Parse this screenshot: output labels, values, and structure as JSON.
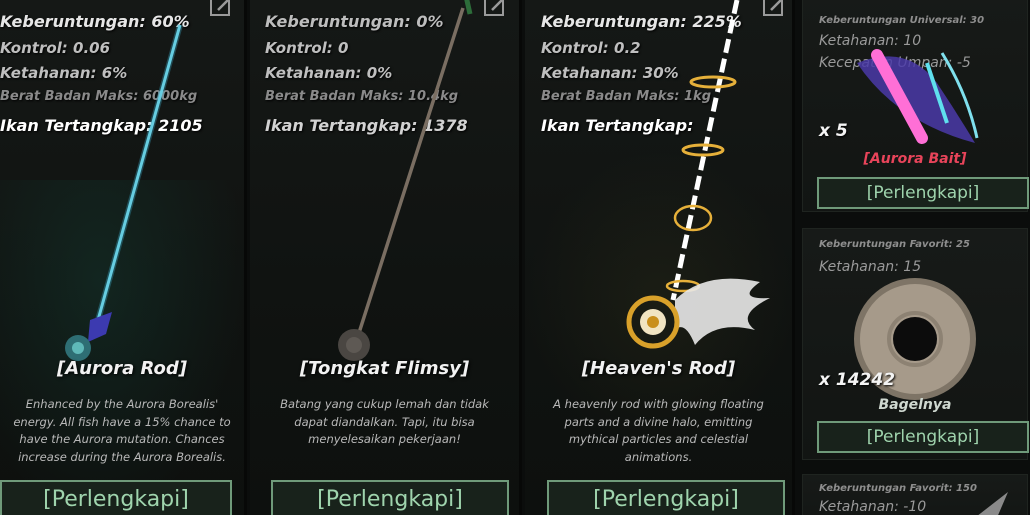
{
  "cards": {
    "aurora": {
      "stats": {
        "luck": "Keberuntungan: 60%",
        "control": "Kontrol: 0.06",
        "resilience": "Ketahanan: 6%",
        "max_weight": "Berat Badan Maks: 6000kg",
        "caught": "Ikan Tertangkap: 2105"
      },
      "name": "[Aurora Rod]",
      "description": "Enhanced by the Aurora Borealis' energy. All fish have a 15% chance to have the Aurora mutation. Chances increase during the Aurora Borealis.",
      "equip_label": "[Perlengkapi]",
      "rod_icon": "aurora-rod-icon"
    },
    "flimsy": {
      "stats": {
        "luck": "Keberuntungan: 0%",
        "control": "Kontrol: 0",
        "resilience": "Ketahanan: 0%",
        "max_weight": "Berat Badan Maks: 10.4kg",
        "caught": "Ikan Tertangkap: 1378"
      },
      "name": "[Tongkat Flimsy]",
      "description": "Batang yang cukup lemah dan tidak dapat diandalkan. Tapi, itu bisa menyelesaikan pekerjaan!",
      "equip_label": "[Perlengkapi]",
      "rod_icon": "flimsy-rod-icon"
    },
    "heaven": {
      "stats": {
        "luck": "Keberuntungan: 225%",
        "control": "Kontrol: 0.2",
        "resilience": "Ketahanan: 30%",
        "max_weight": "Berat Badan Maks: 1kg",
        "caught": "Ikan Tertangkap:"
      },
      "name": "[Heaven's Rod]",
      "description": "A heavenly rod with glowing floating parts and a divine halo, emitting mythical particles and celestial animations.",
      "equip_label": "[Perlengkapi]",
      "rod_icon": "heavens-rod-icon"
    }
  },
  "side": {
    "bait": {
      "tag": "Keberuntungan Universal: 30",
      "stat1": "Ketahanan: 10",
      "stat2": "Kecepatan Umpan: -5",
      "qty": "x 5",
      "name": "[Aurora Bait]",
      "name_color": "#e8445a",
      "equip_label": "[Perlengkapi]",
      "icon": "aurora-bait-icon"
    },
    "bagel": {
      "tag": "Keberuntungan Favorit: 25",
      "stat1": "Ketahanan: 15",
      "qty": "x 14242",
      "name": "Bagelnya",
      "name_color": "#cfd8d0",
      "equip_label": "[Perlengkapi]",
      "icon": "bagel-icon"
    },
    "third": {
      "tag": "Keberuntungan Favorit: 150",
      "stat1": "Ketahanan: -10"
    }
  },
  "colors": {
    "button_border": "#6f9a7a",
    "button_text": "#9fd4ad",
    "panel_bg": "#121513"
  }
}
